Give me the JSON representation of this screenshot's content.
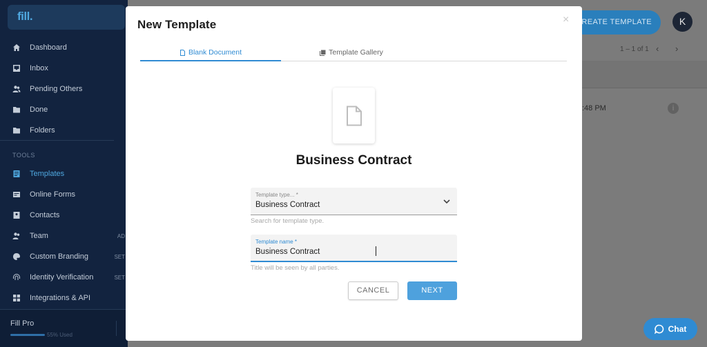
{
  "app": {
    "logo": "fill.",
    "nav": [
      {
        "label": "Dashboard"
      },
      {
        "label": "Inbox"
      },
      {
        "label": "Pending Others"
      },
      {
        "label": "Done"
      },
      {
        "label": "Folders"
      }
    ],
    "tools_heading": "TOOLS",
    "tools": [
      {
        "label": "Templates",
        "tag": ""
      },
      {
        "label": "Online Forms",
        "tag": ""
      },
      {
        "label": "Contacts",
        "tag": ""
      },
      {
        "label": "Team",
        "tag": "AD"
      },
      {
        "label": "Custom Branding",
        "tag": "SET"
      },
      {
        "label": "Identity Verification",
        "tag": "SET"
      },
      {
        "label": "Integrations & API",
        "tag": ""
      }
    ],
    "plan": {
      "name": "Fill Pro",
      "used": "55% Used"
    },
    "header": {
      "create_button": "CREATE TEMPLATE",
      "avatar_initial": "K"
    },
    "pager": {
      "text": "1 – 1 of 1",
      "prev": "‹",
      "next": "›"
    },
    "row": {
      "time": ":48 PM"
    },
    "chat_button": "Chat"
  },
  "modal": {
    "title": "New Template",
    "close": "×",
    "tabs": [
      {
        "label": "Blank Document"
      },
      {
        "label": "Template Gallery"
      }
    ],
    "document_title": "Business Contract",
    "template_type": {
      "label": "Template type... *",
      "value": "Business Contract",
      "helper": "Search for template type."
    },
    "template_name": {
      "label": "Template name *",
      "value": "Business Contract",
      "helper": "Title will be seen by all parties."
    },
    "cancel_button": "CANCEL",
    "next_button": "NEXT"
  },
  "colors": {
    "accent": "#2f8bd3",
    "sidebar": "#12233f",
    "overlay": "#7b7b7b"
  }
}
